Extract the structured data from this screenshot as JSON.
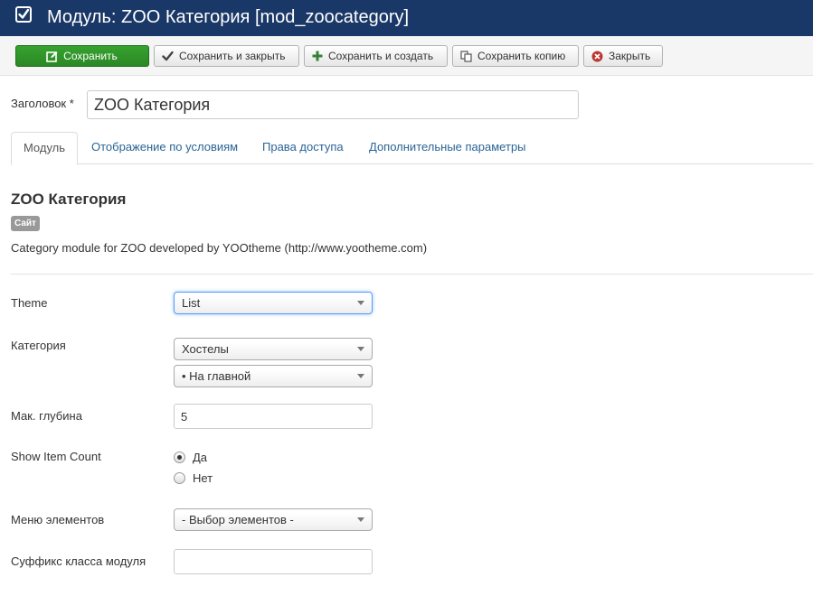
{
  "header": {
    "title": "Модуль: ZOO Категория [mod_zoocategory]"
  },
  "toolbar": {
    "save": "Сохранить",
    "save_close": "Сохранить и закрыть",
    "save_new": "Сохранить и создать",
    "save_copy": "Сохранить копию",
    "close": "Закрыть"
  },
  "form": {
    "title_label": "Заголовок *",
    "title_value": "ZOO Категория"
  },
  "tabs": [
    "Модуль",
    "Отображение по условиям",
    "Права доступа",
    "Дополнительные параметры"
  ],
  "module": {
    "heading": "ZOO Категория",
    "badge": "Сайт",
    "description": "Category module for ZOO developed by YOOtheme (http://www.yootheme.com)"
  },
  "fields": {
    "theme": {
      "label": "Theme",
      "value": "List"
    },
    "category": {
      "label": "Категория",
      "app_value": "Хостелы",
      "category_value": "• На главной"
    },
    "max_depth": {
      "label": "Мак. глубина",
      "value": "5"
    },
    "show_count": {
      "label": "Show Item Count",
      "yes": "Да",
      "no": "Нет",
      "selected": "Да"
    },
    "menu_items": {
      "label": "Меню элементов",
      "value": "- Выбор элементов -"
    },
    "class_suffix": {
      "label": "Суффикс класса модуля",
      "value": ""
    }
  },
  "colors": {
    "header_bg": "#1a3867",
    "save_green": "#2f9627",
    "link_blue": "#2a6496",
    "badge_gray": "#999999"
  },
  "icons": {
    "header": "check-square-icon",
    "save": "edit-icon",
    "save_close": "check-icon",
    "save_new": "plus-icon",
    "save_copy": "copy-icon",
    "close": "cancel-circle-icon"
  }
}
